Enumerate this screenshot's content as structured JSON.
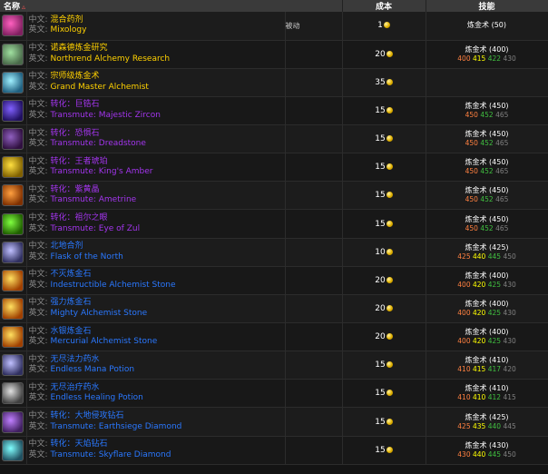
{
  "header": {
    "name_label": "名称",
    "cost_label": "成本",
    "skill_label": "技能"
  },
  "labels": {
    "cn_prefix": "中文:",
    "en_prefix": "英文:"
  },
  "colors": {
    "yellow": "#ffd100",
    "purple": "#a335ee",
    "blue": "#2a78ff"
  },
  "rows": [
    {
      "icon": "mixology-icon",
      "icon_colors": [
        "#ff60c0",
        "#802060"
      ],
      "cn": "混合药剂",
      "en": "Mixology",
      "quality": "yellow",
      "type": "被动",
      "cost": "1",
      "skill_name": "炼金术 (50)",
      "levels": []
    },
    {
      "icon": "research-scroll-icon",
      "icon_colors": [
        "#a0e0a0",
        "#4a6a4a"
      ],
      "cn": "诺森德炼金研究",
      "en": "Northrend Alchemy Research",
      "quality": "yellow",
      "type": "",
      "cost": "20",
      "skill_name": "炼金术 (400)",
      "levels": [
        "400",
        "415",
        "422",
        "430"
      ]
    },
    {
      "icon": "potion-icon",
      "icon_colors": [
        "#a0f0ff",
        "#206080"
      ],
      "cn": "宗师级炼金术",
      "en": "Grand Master Alchemist",
      "quality": "yellow",
      "type": "",
      "cost": "35",
      "skill_name": "",
      "levels": []
    },
    {
      "icon": "gem-icon",
      "icon_colors": [
        "#8060ff",
        "#201060"
      ],
      "cn": "转化：巨锆石",
      "en": "Transmute: Majestic Zircon",
      "quality": "purple",
      "type": "",
      "cost": "15",
      "skill_name": "炼金术 (450)",
      "levels": [
        "450",
        "452",
        "465"
      ]
    },
    {
      "icon": "gem-icon",
      "icon_colors": [
        "#9060c0",
        "#301040"
      ],
      "cn": "转化：恐惧石",
      "en": "Transmute: Dreadstone",
      "quality": "purple",
      "type": "",
      "cost": "15",
      "skill_name": "炼金术 (450)",
      "levels": [
        "450",
        "452",
        "465"
      ]
    },
    {
      "icon": "gem-icon",
      "icon_colors": [
        "#ffe040",
        "#806000"
      ],
      "cn": "转化：王者琥珀",
      "en": "Transmute: King's Amber",
      "quality": "purple",
      "type": "",
      "cost": "15",
      "skill_name": "炼金术 (450)",
      "levels": [
        "450",
        "452",
        "465"
      ]
    },
    {
      "icon": "gem-icon",
      "icon_colors": [
        "#ffa040",
        "#803000"
      ],
      "cn": "转化：紫黄晶",
      "en": "Transmute: Ametrine",
      "quality": "purple",
      "type": "",
      "cost": "15",
      "skill_name": "炼金术 (450)",
      "levels": [
        "450",
        "452",
        "465"
      ]
    },
    {
      "icon": "gem-icon",
      "icon_colors": [
        "#80ff40",
        "#206000"
      ],
      "cn": "转化：祖尔之眼",
      "en": "Transmute: Eye of Zul",
      "quality": "purple",
      "type": "",
      "cost": "15",
      "skill_name": "炼金术 (450)",
      "levels": [
        "450",
        "452",
        "465"
      ]
    },
    {
      "icon": "flask-icon",
      "icon_colors": [
        "#c0c0ff",
        "#303060"
      ],
      "cn": "北地合剂",
      "en": "Flask of the North",
      "quality": "blue",
      "type": "",
      "cost": "10",
      "skill_name": "炼金术 (425)",
      "levels": [
        "425",
        "440",
        "445",
        "450"
      ]
    },
    {
      "icon": "alchemist-stone-icon",
      "icon_colors": [
        "#ffe060",
        "#a04000"
      ],
      "cn": "不灭炼金石",
      "en": "Indestructible Alchemist Stone",
      "quality": "blue",
      "type": "",
      "cost": "20",
      "skill_name": "炼金术 (400)",
      "levels": [
        "400",
        "420",
        "425",
        "430"
      ]
    },
    {
      "icon": "alchemist-stone-icon",
      "icon_colors": [
        "#ffe060",
        "#a04000"
      ],
      "cn": "强力炼金石",
      "en": "Mighty Alchemist Stone",
      "quality": "blue",
      "type": "",
      "cost": "20",
      "skill_name": "炼金术 (400)",
      "levels": [
        "400",
        "420",
        "425",
        "430"
      ]
    },
    {
      "icon": "alchemist-stone-icon",
      "icon_colors": [
        "#ffe060",
        "#a04000"
      ],
      "cn": "水银炼金石",
      "en": "Mercurial Alchemist Stone",
      "quality": "blue",
      "type": "",
      "cost": "20",
      "skill_name": "炼金术 (400)",
      "levels": [
        "400",
        "420",
        "425",
        "430"
      ]
    },
    {
      "icon": "mana-potion-icon",
      "icon_colors": [
        "#c0c0ff",
        "#303060"
      ],
      "cn": "无尽法力药水",
      "en": "Endless Mana Potion",
      "quality": "blue",
      "type": "",
      "cost": "15",
      "skill_name": "炼金术 (410)",
      "levels": [
        "410",
        "415",
        "417",
        "420"
      ]
    },
    {
      "icon": "healing-potion-icon",
      "icon_colors": [
        "#e0e0e0",
        "#404040"
      ],
      "cn": "无尽治疗药水",
      "en": "Endless Healing Potion",
      "quality": "blue",
      "type": "",
      "cost": "15",
      "skill_name": "炼金术 (410)",
      "levels": [
        "410",
        "410",
        "412",
        "415"
      ]
    },
    {
      "icon": "diamond-icon",
      "icon_colors": [
        "#c080ff",
        "#402060"
      ],
      "cn": "转化：大地侵攻钻石",
      "en": "Transmute: Earthsiege Diamond",
      "quality": "blue",
      "type": "",
      "cost": "15",
      "skill_name": "炼金术 (425)",
      "levels": [
        "425",
        "435",
        "440",
        "445"
      ]
    },
    {
      "icon": "diamond-icon",
      "icon_colors": [
        "#80ffff",
        "#205060"
      ],
      "cn": "转化：天焰钻石",
      "en": "Transmute: Skyflare Diamond",
      "quality": "blue",
      "type": "",
      "cost": "15",
      "skill_name": "炼金术 (430)",
      "levels": [
        "430",
        "440",
        "445",
        "450"
      ]
    }
  ]
}
